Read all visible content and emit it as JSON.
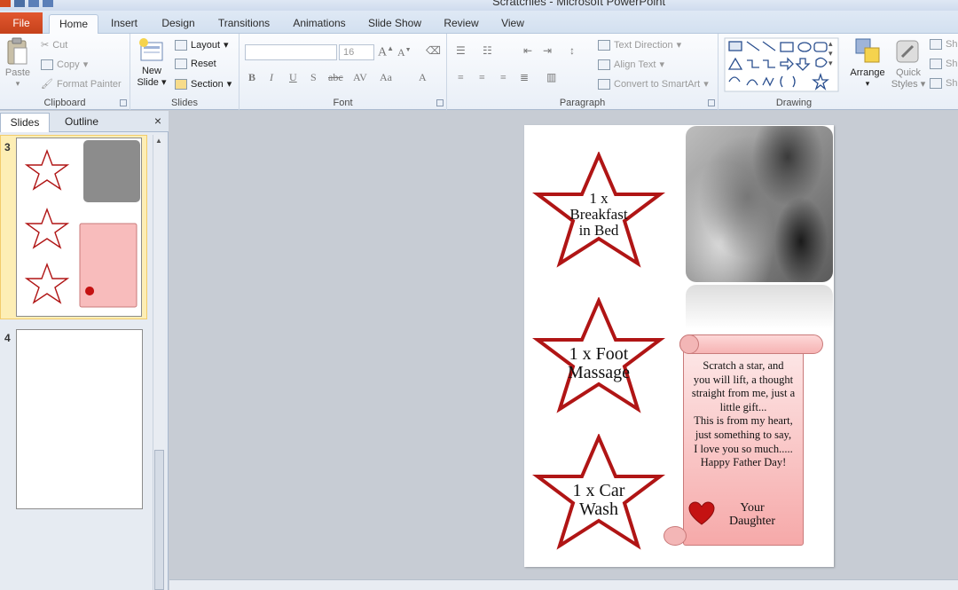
{
  "window": {
    "title": "Scratchies - Microsoft PowerPoint"
  },
  "tabs": [
    "File",
    "Home",
    "Insert",
    "Design",
    "Transitions",
    "Animations",
    "Slide Show",
    "Review",
    "View"
  ],
  "active_tab": "Home",
  "ribbon": {
    "clipboard": {
      "label": "Clipboard",
      "paste": "Paste",
      "cut": "Cut",
      "copy": "Copy",
      "format_painter": "Format Painter"
    },
    "slides": {
      "label": "Slides",
      "new_slide": "New Slide",
      "layout": "Layout",
      "reset": "Reset",
      "section": "Section"
    },
    "font": {
      "label": "Font",
      "font_name": "",
      "font_size": "16"
    },
    "paragraph": {
      "label": "Paragraph",
      "text_direction": "Text Direction",
      "align_text": "Align Text",
      "convert_smartart": "Convert to SmartArt"
    },
    "drawing": {
      "label": "Drawing",
      "arrange": "Arrange",
      "quick_styles": "Quick Styles",
      "shape_fill": "Sh",
      "shape_outline": "Sh",
      "shape_effects": "Sh"
    }
  },
  "pane": {
    "tab_slides": "Slides",
    "tab_outline": "Outline",
    "close": "×",
    "slide_numbers": [
      "3",
      "4"
    ]
  },
  "slide": {
    "stars": [
      {
        "lines": [
          "1 x",
          "Breakfast",
          "in Bed"
        ]
      },
      {
        "lines": [
          "1 x Foot",
          "Massage"
        ]
      },
      {
        "lines": [
          "1 x Car",
          "Wash"
        ]
      }
    ],
    "poem_lines": [
      "Scratch a star, and",
      "you will lift, a thought",
      "straight from me, just a",
      "little gift...",
      "This is from my heart,",
      "just something to say,",
      "I love you so much.....",
      "Happy Father Day!"
    ],
    "signature": [
      "Your",
      "Daughter"
    ]
  },
  "colors": {
    "star_outline": "#b01515",
    "heart": "#c41212",
    "scroll_fill": "#f7b4b4",
    "file_tab": "#d24a1f"
  }
}
